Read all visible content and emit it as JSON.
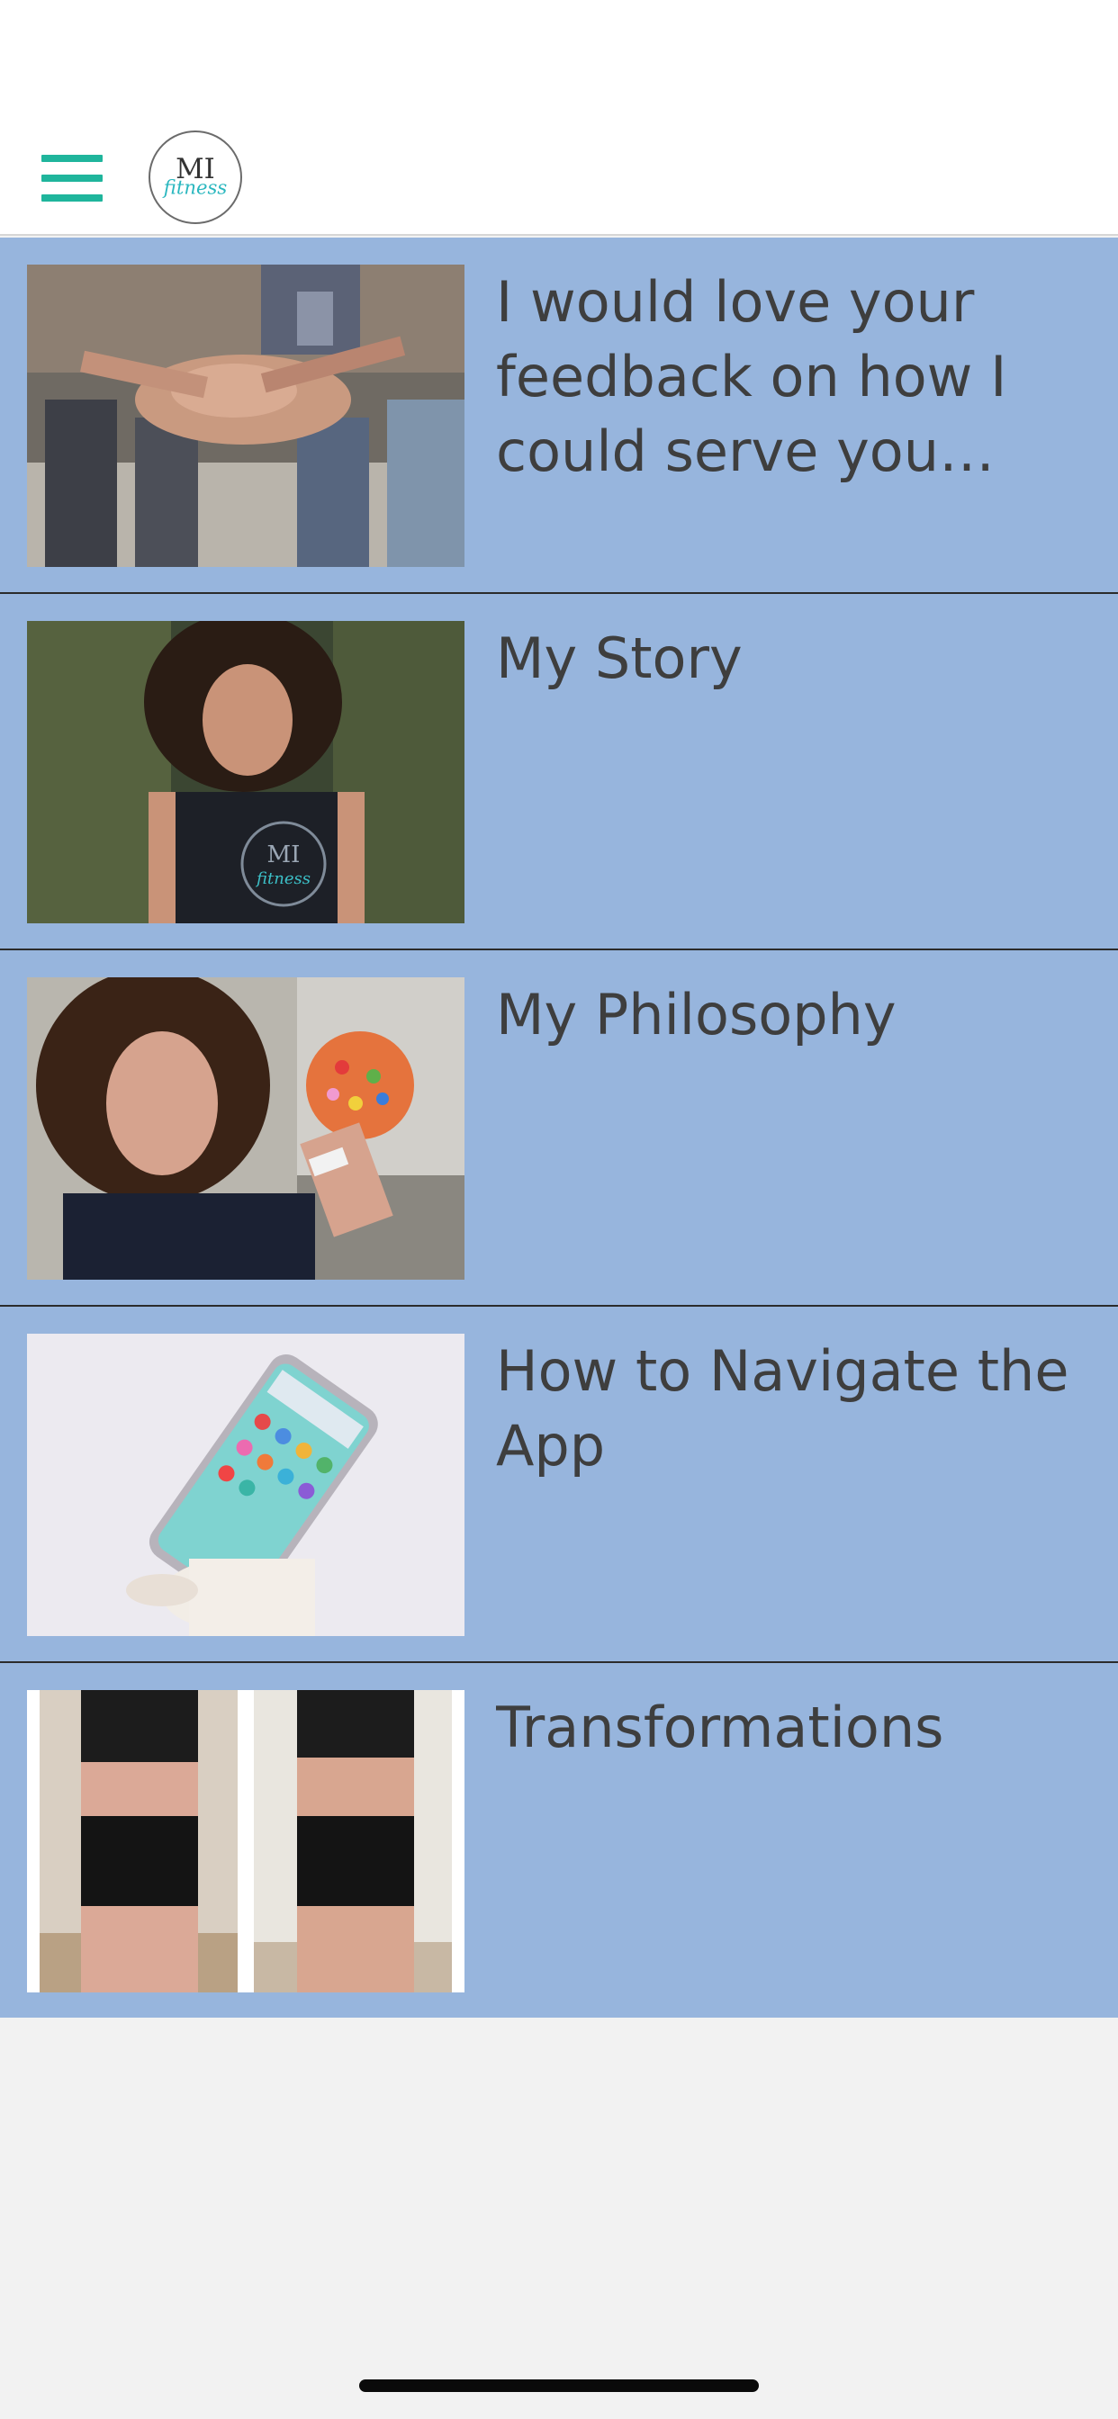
{
  "header": {
    "menu_icon": "hamburger-menu-icon",
    "logo_text_top": "MI",
    "logo_text_bottom": "fitness",
    "accent_color": "#1fb59c"
  },
  "list": {
    "background": "#97b5dd",
    "items": [
      {
        "title": "I would love your feedback on how I could serve you better!",
        "thumb": "hands-together-photo"
      },
      {
        "title": "My Story",
        "thumb": "woman-smiling-tank-top-photo"
      },
      {
        "title": "My Philosophy",
        "thumb": "woman-holding-candy-donut-photo"
      },
      {
        "title": "How to Navigate the App",
        "thumb": "hand-holding-phone-photo"
      },
      {
        "title": "Transformations",
        "thumb": "before-after-transformation-photo"
      }
    ]
  }
}
